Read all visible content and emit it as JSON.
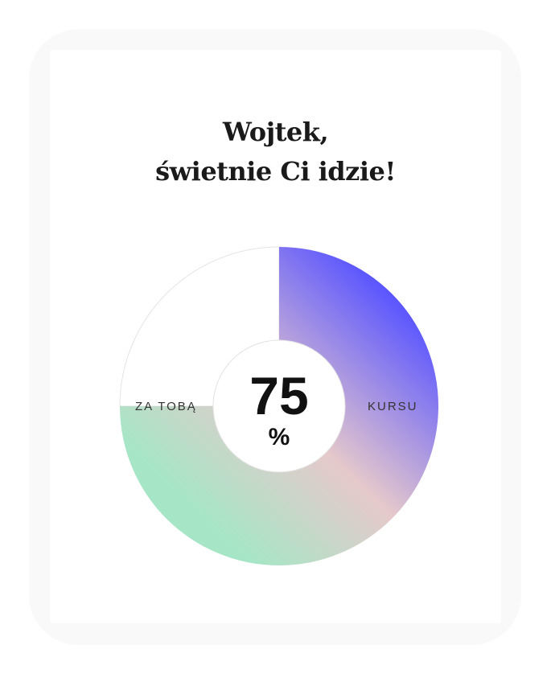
{
  "greeting": {
    "line1": "Wojtek,",
    "line2": "świetnie Ci idzie!"
  },
  "progress": {
    "value": "75",
    "unit": "%",
    "fraction": 0.75,
    "label_done": "ZA TOBĄ",
    "label_course": "KURSU"
  },
  "colors": {
    "gradient_start": "#5a55ff",
    "gradient_mid": "#e6c9cb",
    "gradient_end": "#a6e6c6",
    "remaining": "#ffffff",
    "text": "#111111"
  }
}
